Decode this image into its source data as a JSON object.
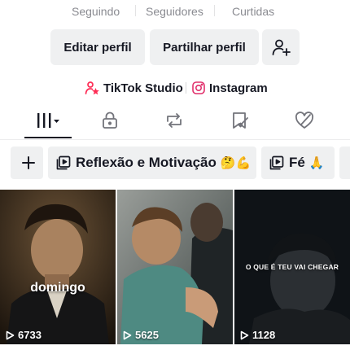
{
  "stats": {
    "following_label": "Seguindo",
    "followers_label": "Seguidores",
    "likes_label": "Curtidas"
  },
  "actions": {
    "edit_profile": "Editar perfil",
    "share_profile": "Partilhar perfil"
  },
  "links": {
    "studio": "TikTok Studio",
    "instagram": "Instagram"
  },
  "colors": {
    "tiktok_pink": "#fe2c55",
    "instagram_pink": "#e1306c",
    "button_bg": "#eff0f1",
    "muted_text": "#8a8b91"
  },
  "tabs": [
    {
      "icon": "videos-grid-icon",
      "active": true
    },
    {
      "icon": "lock-icon",
      "active": false
    },
    {
      "icon": "repost-icon",
      "active": false
    },
    {
      "icon": "favorites-icon",
      "active": false
    },
    {
      "icon": "liked-heart-icon",
      "active": false
    }
  ],
  "playlists": {
    "add_icon": "plus-icon",
    "items": [
      {
        "label": "Reflexão e Motivação",
        "emoji": "🤔💪"
      },
      {
        "label": "Fé",
        "emoji": "🙏"
      }
    ]
  },
  "videos": [
    {
      "views": "6733",
      "caption": "domingo"
    },
    {
      "views": "5625",
      "caption": ""
    },
    {
      "views": "1128",
      "caption": "O QUE É TEU VAI CHEGAR"
    }
  ]
}
